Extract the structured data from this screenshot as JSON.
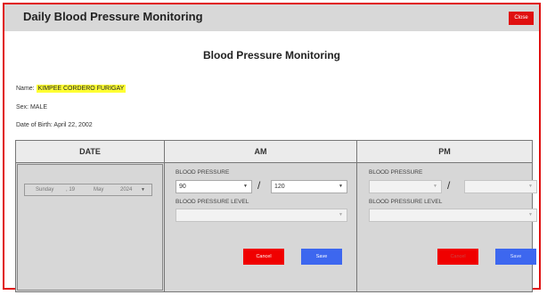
{
  "window": {
    "title": "Daily Blood Pressure Monitoring",
    "close_label": "Close"
  },
  "form": {
    "heading": "Blood Pressure Monitoring",
    "name_label": "Name:",
    "name_value": "KIMPEE CORDERO FURIGAY",
    "sex_label": "Sex:",
    "sex_value": "MALE",
    "dob_label": "Date of Birth:",
    "dob_value": "April 22, 2002"
  },
  "table": {
    "columns": [
      "DATE",
      "AM",
      "PM"
    ],
    "date": {
      "weekday": "Sunday",
      "day": ", 19",
      "month": "May",
      "year": "2024"
    },
    "am": {
      "bp_label": "BLOOD PRESSURE",
      "systolic": "90",
      "separator": "/",
      "diastolic": "120",
      "level_label": "BLOOD PRESSURE LEVEL",
      "level_value": "",
      "cancel_label": "Cancel",
      "save_label": "Save"
    },
    "pm": {
      "bp_label": "BLOOD PRESSURE",
      "systolic": "",
      "separator": "/",
      "diastolic": "",
      "level_label": "BLOOD PRESSURE LEVEL",
      "level_value": "",
      "cancel_label": "Cancel",
      "save_label": "Save"
    }
  },
  "colors": {
    "accent": "#e01010",
    "save": "#3d67ef",
    "highlight": "#ffff33"
  }
}
